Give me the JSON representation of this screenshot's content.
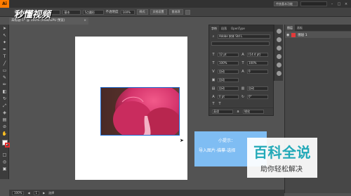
{
  "app": {
    "logo": "Ai"
  },
  "menubar": {
    "items": [
      "",
      "",
      "",
      "",
      "",
      "",
      "",
      "",
      ""
    ],
    "workspace": "传统基本功能",
    "window_controls": [
      "–",
      "□",
      "×"
    ]
  },
  "controlbar": {
    "label_left": "未选择对象",
    "field_1": "基本",
    "field_2": "5点圆形",
    "field_3": "不透明度",
    "field_4": "100%",
    "btn_1": "样式",
    "btn_2": "文档设置",
    "btn_3": "首选项"
  },
  "doctab": {
    "title": "未标题-1* @ 100% (RGB/GPU 预览)",
    "close": "×"
  },
  "site_logo": "秒懂视频",
  "character_panel": {
    "tabs": [
      "字符",
      "段落",
      "OpenType"
    ],
    "font_name": "Adobe 宋体 Std L",
    "font_size": "12 pt",
    "leading": "(14.4 pt)",
    "scale_h": "100%",
    "scale_v": "100%",
    "kerning": "自动",
    "tracking": "0",
    "auto_1": "自动",
    "auto_2": "自动",
    "auto_3": "自动",
    "baseline": "0 pt",
    "rotation": "0°",
    "language": "英语",
    "aa": "锐化"
  },
  "layers_panel": {
    "tabs": [
      "图层",
      "画板"
    ],
    "layer_name": "图层 1"
  },
  "tip": {
    "title": "小提示：",
    "text": "导入图片-描摹-选择"
  },
  "watermark": {
    "big": "百科全说",
    "small": "助你轻松解决"
  },
  "statusbar": {
    "zoom": "100%",
    "page": "1",
    "mode": "选择"
  },
  "colors": {
    "tip_bg": "#7fbdf3",
    "watermark_teal": "#22a9b8",
    "app_orange": "#ff7c00"
  }
}
